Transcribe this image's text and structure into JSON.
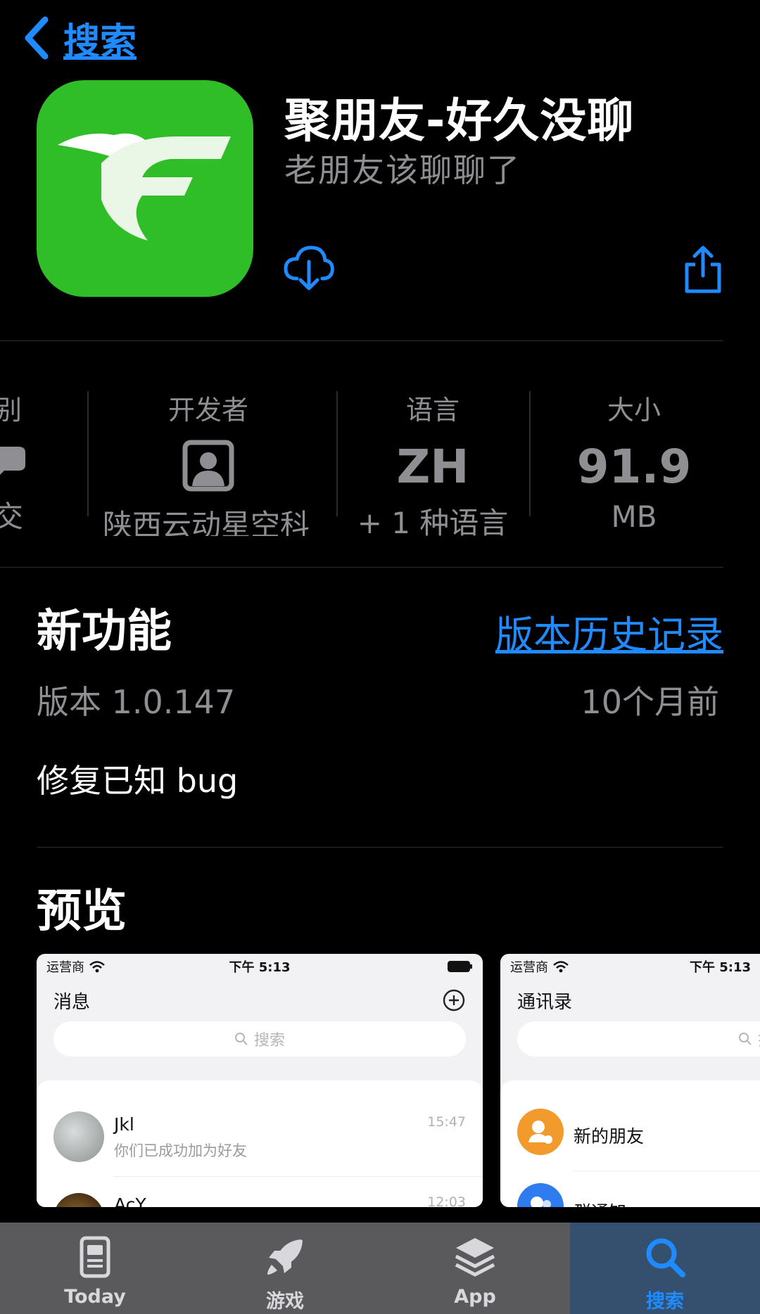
{
  "nav": {
    "back_label": "搜索"
  },
  "app": {
    "title": "聚朋友-好久没聊",
    "subtitle": "老朋友该聊聊了"
  },
  "info": {
    "category": {
      "label": "别",
      "value": "交"
    },
    "developer": {
      "label": "开发者",
      "value": "陕西云动星空科"
    },
    "language": {
      "label": "语言",
      "big": "ZH",
      "sub": "+ 1 种语言"
    },
    "size": {
      "label": "大小",
      "big": "91.9",
      "unit": "MB"
    }
  },
  "whats_new": {
    "title": "新功能",
    "history_link": "版本历史记录",
    "version": "版本 1.0.147",
    "date": "10个月前",
    "notes": "修复已知 bug"
  },
  "preview": {
    "title": "预览",
    "shots": [
      {
        "carrier": "运营商",
        "time": "下午 5:13",
        "heading": "消息",
        "search_placeholder": "搜索",
        "rows": [
          {
            "name": "Jkl",
            "message": "你们已成功加为好友",
            "time": "15:47"
          },
          {
            "name": "AcY",
            "message": "",
            "time": "12:03"
          }
        ]
      },
      {
        "carrier": "运营商",
        "time": "下午 5:13",
        "heading": "通讯录",
        "search_placeholder": "搜索",
        "rows": [
          {
            "name": "新的朋友"
          },
          {
            "name": "群通知"
          }
        ]
      }
    ]
  },
  "tabs": [
    {
      "label": "Today",
      "icon": "today-icon",
      "active": false
    },
    {
      "label": "游戏",
      "icon": "rocket-icon",
      "active": false
    },
    {
      "label": "App",
      "icon": "app-stack-icon",
      "active": false
    },
    {
      "label": "搜索",
      "icon": "search-icon",
      "active": true
    }
  ],
  "colors": {
    "accent": "#1f8bff",
    "app_green": "#2fbd28",
    "secondary_text": "#8e8e93"
  }
}
